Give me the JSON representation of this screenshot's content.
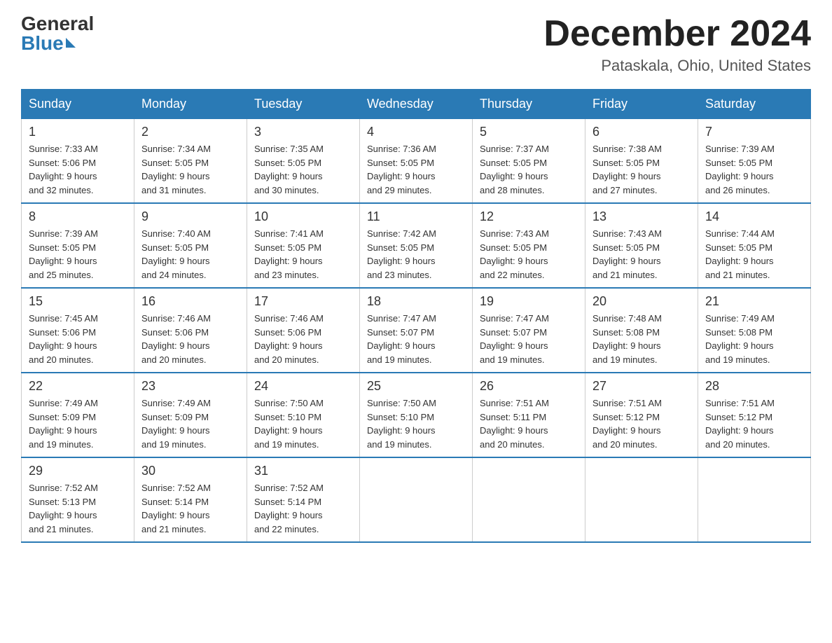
{
  "header": {
    "logo_general": "General",
    "logo_blue": "Blue",
    "month_title": "December 2024",
    "location": "Pataskala, Ohio, United States"
  },
  "weekdays": [
    "Sunday",
    "Monday",
    "Tuesday",
    "Wednesday",
    "Thursday",
    "Friday",
    "Saturday"
  ],
  "weeks": [
    [
      {
        "day": "1",
        "sunrise": "7:33 AM",
        "sunset": "5:06 PM",
        "daylight": "9 hours and 32 minutes."
      },
      {
        "day": "2",
        "sunrise": "7:34 AM",
        "sunset": "5:05 PM",
        "daylight": "9 hours and 31 minutes."
      },
      {
        "day": "3",
        "sunrise": "7:35 AM",
        "sunset": "5:05 PM",
        "daylight": "9 hours and 30 minutes."
      },
      {
        "day": "4",
        "sunrise": "7:36 AM",
        "sunset": "5:05 PM",
        "daylight": "9 hours and 29 minutes."
      },
      {
        "day": "5",
        "sunrise": "7:37 AM",
        "sunset": "5:05 PM",
        "daylight": "9 hours and 28 minutes."
      },
      {
        "day": "6",
        "sunrise": "7:38 AM",
        "sunset": "5:05 PM",
        "daylight": "9 hours and 27 minutes."
      },
      {
        "day": "7",
        "sunrise": "7:39 AM",
        "sunset": "5:05 PM",
        "daylight": "9 hours and 26 minutes."
      }
    ],
    [
      {
        "day": "8",
        "sunrise": "7:39 AM",
        "sunset": "5:05 PM",
        "daylight": "9 hours and 25 minutes."
      },
      {
        "day": "9",
        "sunrise": "7:40 AM",
        "sunset": "5:05 PM",
        "daylight": "9 hours and 24 minutes."
      },
      {
        "day": "10",
        "sunrise": "7:41 AM",
        "sunset": "5:05 PM",
        "daylight": "9 hours and 23 minutes."
      },
      {
        "day": "11",
        "sunrise": "7:42 AM",
        "sunset": "5:05 PM",
        "daylight": "9 hours and 23 minutes."
      },
      {
        "day": "12",
        "sunrise": "7:43 AM",
        "sunset": "5:05 PM",
        "daylight": "9 hours and 22 minutes."
      },
      {
        "day": "13",
        "sunrise": "7:43 AM",
        "sunset": "5:05 PM",
        "daylight": "9 hours and 21 minutes."
      },
      {
        "day": "14",
        "sunrise": "7:44 AM",
        "sunset": "5:05 PM",
        "daylight": "9 hours and 21 minutes."
      }
    ],
    [
      {
        "day": "15",
        "sunrise": "7:45 AM",
        "sunset": "5:06 PM",
        "daylight": "9 hours and 20 minutes."
      },
      {
        "day": "16",
        "sunrise": "7:46 AM",
        "sunset": "5:06 PM",
        "daylight": "9 hours and 20 minutes."
      },
      {
        "day": "17",
        "sunrise": "7:46 AM",
        "sunset": "5:06 PM",
        "daylight": "9 hours and 20 minutes."
      },
      {
        "day": "18",
        "sunrise": "7:47 AM",
        "sunset": "5:07 PM",
        "daylight": "9 hours and 19 minutes."
      },
      {
        "day": "19",
        "sunrise": "7:47 AM",
        "sunset": "5:07 PM",
        "daylight": "9 hours and 19 minutes."
      },
      {
        "day": "20",
        "sunrise": "7:48 AM",
        "sunset": "5:08 PM",
        "daylight": "9 hours and 19 minutes."
      },
      {
        "day": "21",
        "sunrise": "7:49 AM",
        "sunset": "5:08 PM",
        "daylight": "9 hours and 19 minutes."
      }
    ],
    [
      {
        "day": "22",
        "sunrise": "7:49 AM",
        "sunset": "5:09 PM",
        "daylight": "9 hours and 19 minutes."
      },
      {
        "day": "23",
        "sunrise": "7:49 AM",
        "sunset": "5:09 PM",
        "daylight": "9 hours and 19 minutes."
      },
      {
        "day": "24",
        "sunrise": "7:50 AM",
        "sunset": "5:10 PM",
        "daylight": "9 hours and 19 minutes."
      },
      {
        "day": "25",
        "sunrise": "7:50 AM",
        "sunset": "5:10 PM",
        "daylight": "9 hours and 19 minutes."
      },
      {
        "day": "26",
        "sunrise": "7:51 AM",
        "sunset": "5:11 PM",
        "daylight": "9 hours and 20 minutes."
      },
      {
        "day": "27",
        "sunrise": "7:51 AM",
        "sunset": "5:12 PM",
        "daylight": "9 hours and 20 minutes."
      },
      {
        "day": "28",
        "sunrise": "7:51 AM",
        "sunset": "5:12 PM",
        "daylight": "9 hours and 20 minutes."
      }
    ],
    [
      {
        "day": "29",
        "sunrise": "7:52 AM",
        "sunset": "5:13 PM",
        "daylight": "9 hours and 21 minutes."
      },
      {
        "day": "30",
        "sunrise": "7:52 AM",
        "sunset": "5:14 PM",
        "daylight": "9 hours and 21 minutes."
      },
      {
        "day": "31",
        "sunrise": "7:52 AM",
        "sunset": "5:14 PM",
        "daylight": "9 hours and 22 minutes."
      },
      null,
      null,
      null,
      null
    ]
  ],
  "labels": {
    "sunrise": "Sunrise:",
    "sunset": "Sunset:",
    "daylight": "Daylight:"
  }
}
